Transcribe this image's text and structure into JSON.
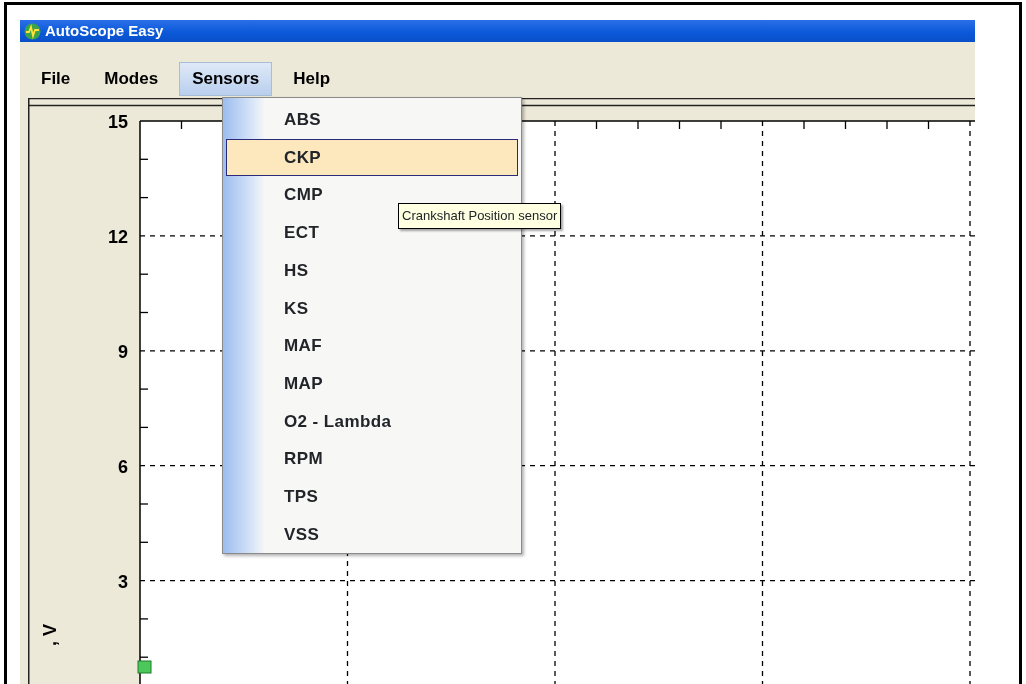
{
  "window": {
    "title": "AutoScope Easy"
  },
  "menu_bar": [
    {
      "label": "File",
      "selected": false
    },
    {
      "label": "Modes",
      "selected": false
    },
    {
      "label": "Sensors",
      "selected": true
    },
    {
      "label": "Help",
      "selected": false
    }
  ],
  "dropdown": {
    "items": [
      {
        "label": "ABS",
        "selected": false
      },
      {
        "label": "CKP",
        "selected": true
      },
      {
        "label": "CMP",
        "selected": false
      },
      {
        "label": "ECT",
        "selected": false
      },
      {
        "label": "HS",
        "selected": false
      },
      {
        "label": "KS",
        "selected": false
      },
      {
        "label": "MAF",
        "selected": false
      },
      {
        "label": "MAP",
        "selected": false
      },
      {
        "label": "O2 - Lambda",
        "selected": false
      },
      {
        "label": "RPM",
        "selected": false
      },
      {
        "label": "TPS",
        "selected": false
      },
      {
        "label": "VSS",
        "selected": false
      }
    ]
  },
  "tooltip": "Crankshaft Position sensor",
  "plot": {
    "y_ticks": [
      "15",
      "12",
      "9",
      "6",
      "3"
    ],
    "axis_label": ", V"
  }
}
